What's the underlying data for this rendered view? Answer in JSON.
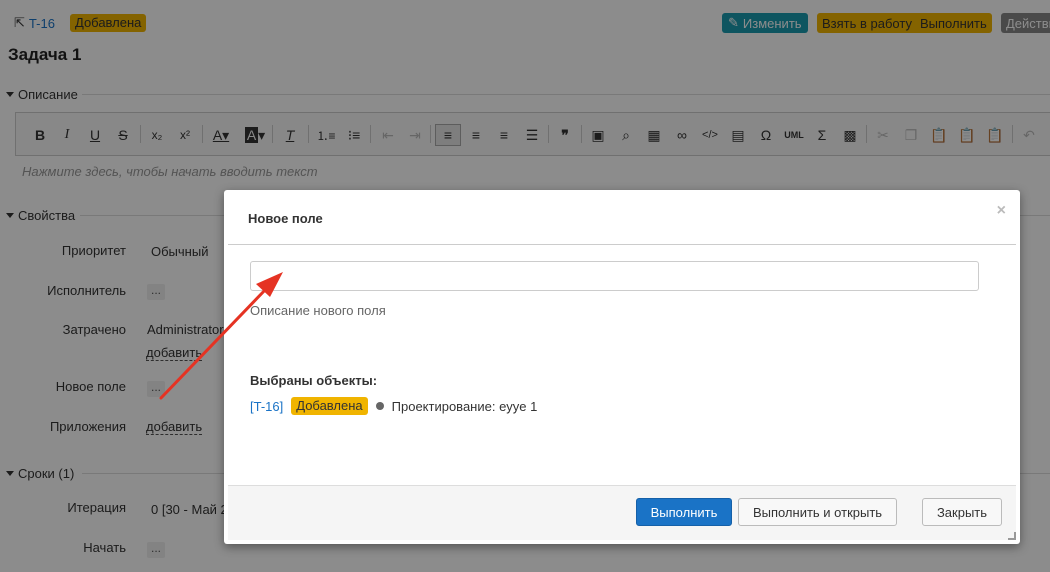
{
  "header": {
    "task_id": "T-16",
    "status": "Добавлена",
    "edit_label": "Изменить",
    "take_label": "Взять в работу",
    "complete_label": "Выполнить",
    "actions_label": "Действия"
  },
  "task": {
    "title": "Задача 1"
  },
  "sections": {
    "description": "Описание",
    "properties": "Свойства",
    "deadlines": "Сроки (1)"
  },
  "editor": {
    "placeholder": "Нажмите здесь, чтобы начать вводить текст",
    "buttons": [
      "bold",
      "italic",
      "underline",
      "strike",
      "subscript",
      "superscript",
      "text-color",
      "bg-color",
      "clear-format",
      "numbered-list",
      "bulleted-list",
      "outdent",
      "indent",
      "align-left",
      "align-center",
      "align-right",
      "justify",
      "blockquote",
      "image",
      "find",
      "table",
      "link",
      "source",
      "preview",
      "special-char",
      "uml",
      "formula",
      "template",
      "cut",
      "copy",
      "paste",
      "paste-text",
      "paste-word",
      "undo"
    ]
  },
  "properties": {
    "priority_label": "Приоритет",
    "priority_value": "Обычный",
    "assignee_label": "Исполнитель",
    "assignee_value": "...",
    "spent_label": "Затрачено",
    "spent_value": "Administrator",
    "spent_add": "добавить",
    "newfield_label": "Новое поле",
    "newfield_value": "...",
    "attachments_label": "Приложения",
    "attachments_add": "добавить",
    "iteration_label": "Итерация",
    "iteration_value": "0 [30 - Май 2",
    "start_label": "Начать",
    "start_value": "..."
  },
  "modal": {
    "title": "Новое поле",
    "close": "×",
    "input_value": "",
    "field_description": "Описание нового поля",
    "selected_title": "Выбраны объекты:",
    "item_id": "[T-16]",
    "item_status": "Добавлена",
    "item_name": "Проектирование: eyye 1",
    "btn_complete": "Выполнить",
    "btn_complete_open": "Выполнить и открыть",
    "btn_close": "Закрыть"
  },
  "colors": {
    "status_badge": "#f0b400",
    "edit_button": "#1a9bb0",
    "primary_button": "#1a73c6",
    "annotation_arrow": "#e53323"
  }
}
